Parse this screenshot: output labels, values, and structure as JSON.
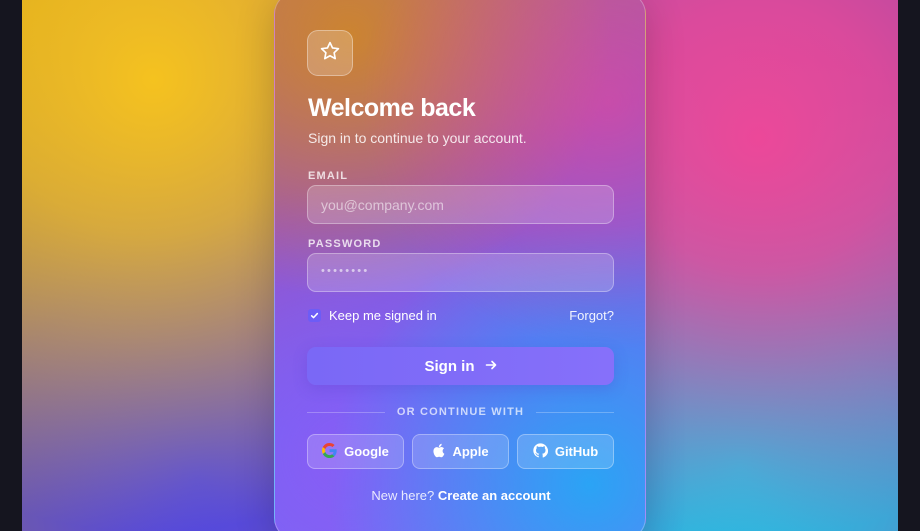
{
  "brand": {
    "logo_icon": "star-icon"
  },
  "heading": {
    "title": "Welcome back",
    "subtitle": "Sign in to continue to your account."
  },
  "email": {
    "label": "EMAIL",
    "placeholder": "you@company.com",
    "value": ""
  },
  "password": {
    "label": "PASSWORD",
    "masked_value": "••••••••"
  },
  "remember": {
    "label": "Keep me signed in",
    "checked": true
  },
  "forgot": {
    "label": "Forgot?"
  },
  "signin": {
    "label": "Sign in",
    "icon": "arrow-right-icon"
  },
  "divider": {
    "text": "OR CONTINUE WITH"
  },
  "social": [
    {
      "label": "Google",
      "icon": "google-icon"
    },
    {
      "label": "Apple",
      "icon": "apple-icon"
    },
    {
      "label": "GitHub",
      "icon": "github-icon"
    }
  ],
  "footer": {
    "prompt": "New here?",
    "link": "Create an account"
  },
  "colors": {
    "accent": "#7a68f6",
    "text": "#ffffff"
  }
}
